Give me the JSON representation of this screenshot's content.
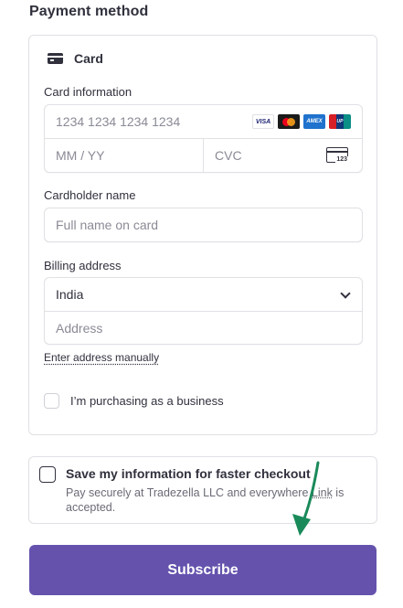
{
  "section_title": "Payment method",
  "method": {
    "label": "Card",
    "icon": "credit-card-icon"
  },
  "card_info": {
    "label": "Card information",
    "number_placeholder": "1234 1234 1234 1234",
    "expiry_placeholder": "MM / YY",
    "cvc_placeholder": "CVC",
    "cvc_icon_text": "123",
    "brands": [
      "VISA",
      "Mastercard",
      "Amex",
      "UnionPay"
    ]
  },
  "cardholder": {
    "label": "Cardholder name",
    "placeholder": "Full name on card"
  },
  "billing": {
    "label": "Billing address",
    "country": "India",
    "address_placeholder": "Address",
    "manual_link": "Enter address manually"
  },
  "business_checkbox": {
    "label": "I’m purchasing as a business",
    "checked": false
  },
  "save_info": {
    "title": "Save my information for faster checkout",
    "desc_before": "Pay securely at Tradezella LLC and everywhere ",
    "desc_link": "Link",
    "desc_after": " is accepted.",
    "checked": false
  },
  "subscribe_label": "Subscribe",
  "colors": {
    "accent": "#6452ad",
    "annotation_arrow": "#1a8a5a"
  }
}
